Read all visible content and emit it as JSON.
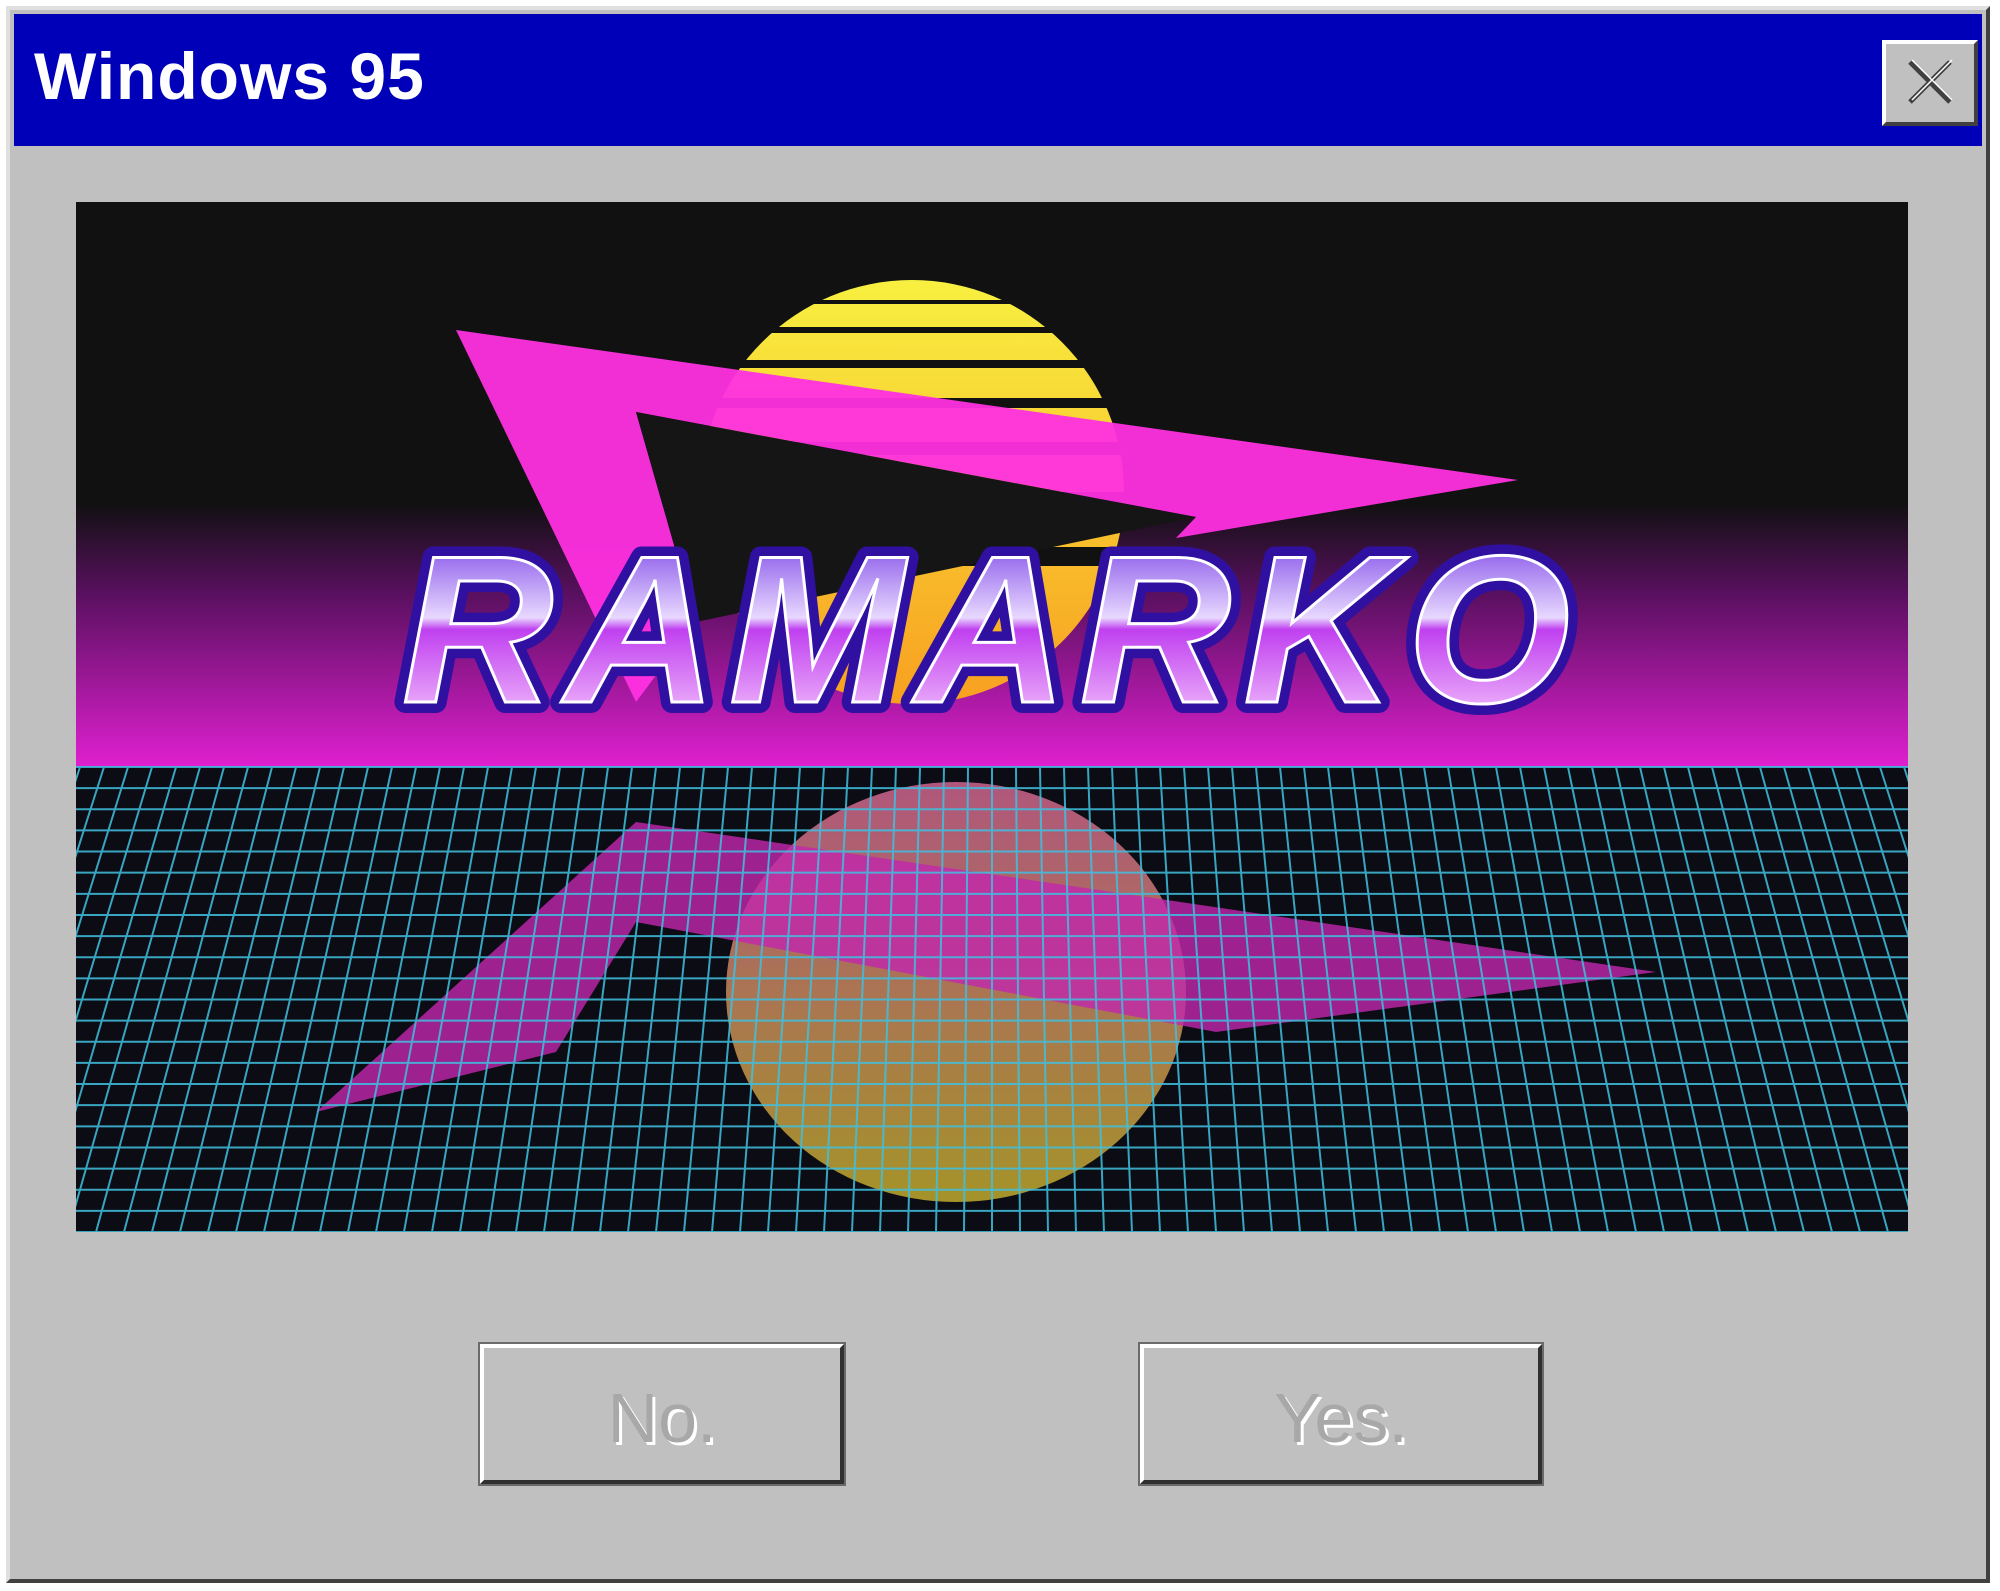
{
  "window": {
    "title": "Windows 95",
    "close_icon": "close-x-icon"
  },
  "artwork": {
    "logo_text": "RAMARKO",
    "colors": {
      "sky": "#101010",
      "horizon_glow": "#e020d0",
      "sun": "#f8e030",
      "triangle": "#ff30e0",
      "grid_lines": "#40c0e0",
      "logo_fill_top": "#7030e0",
      "logo_fill_bottom": "#f8d0ff"
    }
  },
  "buttons": {
    "no_label": "No.",
    "yes_label": "Yes."
  },
  "colors": {
    "titlebar": "#0000b8",
    "window_face": "#c0c0c0"
  }
}
